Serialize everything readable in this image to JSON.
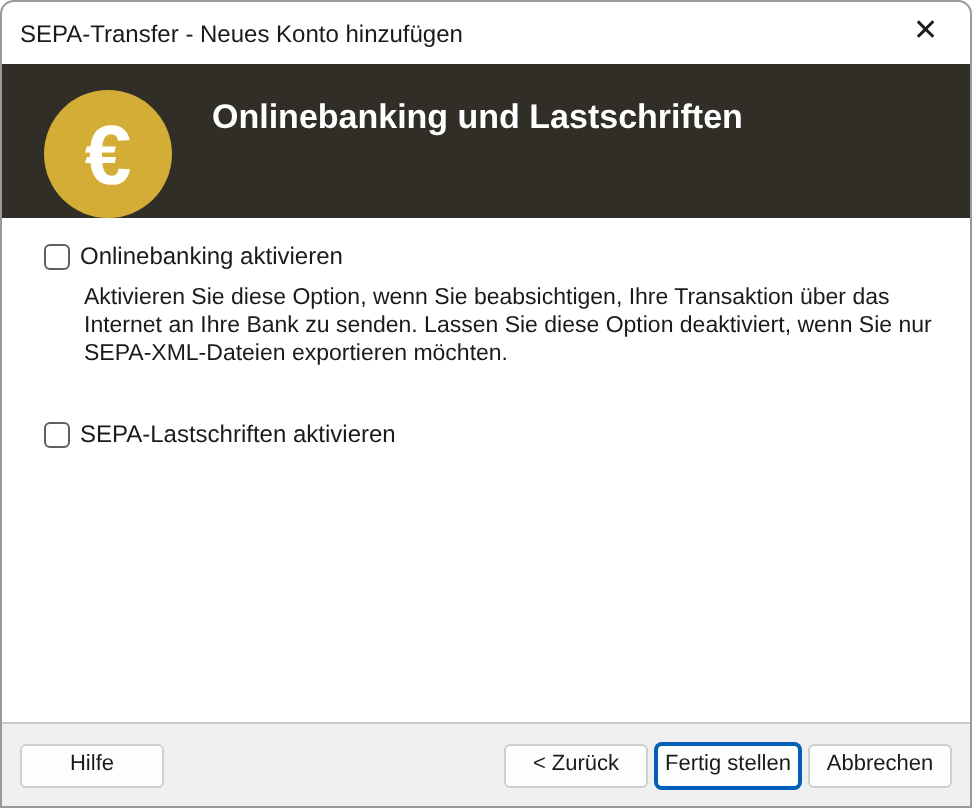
{
  "window": {
    "title": "SEPA-Transfer - Neues Konto hinzufügen",
    "close": "✕"
  },
  "header": {
    "title": "Onlinebanking und Lastschriften",
    "icon": "€"
  },
  "options": [
    {
      "label": "Onlinebanking aktivieren",
      "checked": false,
      "description": "Aktivieren Sie diese Option, wenn Sie beabsichtigen, Ihre Transaktion über das Internet an Ihre Bank zu senden. Lassen Sie diese Option deaktiviert, wenn Sie nur SEPA-XML-Dateien exportieren möchten."
    },
    {
      "label": "SEPA-Lastschriften aktivieren",
      "checked": false
    }
  ],
  "buttons_left": [
    {
      "label": "Hilfe",
      "focused": false
    }
  ],
  "buttons_right": [
    {
      "label": "< Zurück",
      "focused": false
    },
    {
      "label": "Fertig stellen",
      "focused": true
    },
    {
      "label": "Abbrechen",
      "focused": false
    }
  ]
}
